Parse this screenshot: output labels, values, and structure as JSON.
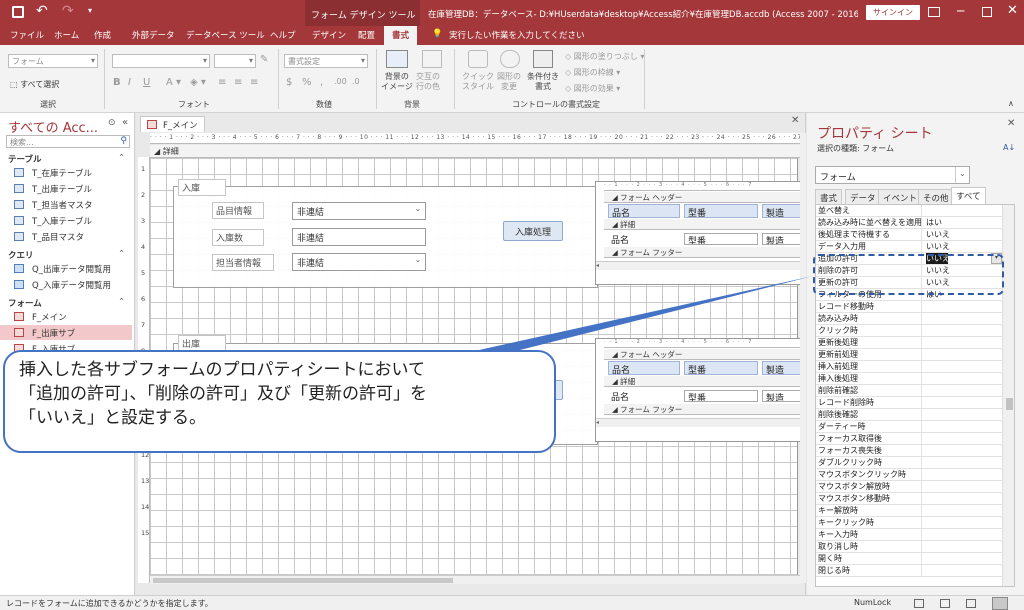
{
  "window": {
    "title": "在庫管理DB：データベース- D:¥HUserdata¥desktop¥Access紹介¥在庫管理DB.accdb (Access 2007 - 2016 フ...",
    "context_tab": "フォーム デザイン ツール",
    "signin": "サインイン"
  },
  "menu": {
    "tabs": [
      "ファイル",
      "ホーム",
      "作成",
      "外部データ",
      "データベース ツール",
      "ヘルプ",
      "デザイン",
      "配置",
      "書式"
    ],
    "active_tab": "書式",
    "tell_me": "実行したい作業を入力してください"
  },
  "ribbon": {
    "selection_combo": "フォーム",
    "select_all": "すべて選択",
    "group_selection": "選択",
    "font_combo": "",
    "group_font": "フォント",
    "number_format_combo": "書式設定",
    "group_number": "数値",
    "bg_image": "背景の\nイメージ",
    "alt_row_color": "交互の\n行の色",
    "group_background": "背景",
    "quick_style": "クイック\nスタイル",
    "change_shape": "図形の\n変更",
    "conditional_format": "条件付き\n書式",
    "shape_fill": "図形の塗りつぶし",
    "shape_outline": "図形の枠線",
    "shape_effects": "図形の効果",
    "group_control_format": "コントロールの書式設定"
  },
  "nav": {
    "header": "すべての Acc...",
    "search_placeholder": "検索...",
    "sections": [
      {
        "label": "テーブル",
        "items": [
          "T_在庫テーブル",
          "T_出庫テーブル",
          "T_担当者マスタ",
          "T_入庫テーブル",
          "T_品目マスタ"
        ]
      },
      {
        "label": "クエリ",
        "items": [
          "Q_出庫データ閲覧用",
          "Q_入庫データ閲覧用"
        ]
      },
      {
        "label": "フォーム",
        "items": [
          "F_メイン",
          "F_出庫サブ",
          "F_入庫サブ"
        ]
      }
    ],
    "selected": "F_出庫サブ"
  },
  "designer": {
    "doc_tab": "F_メイン",
    "section_detail": "詳細",
    "group_in": "入庫",
    "group_out": "出庫",
    "label_item": "品目情報",
    "label_qty": "入庫数",
    "label_staff": "担当者情報",
    "unbound": "非連結",
    "btn_in": "入庫処理",
    "ruler_numbers": [
      "1",
      "2",
      "3",
      "4",
      "5",
      "6",
      "7",
      "8",
      "9",
      "10",
      "11",
      "12",
      "13",
      "14",
      "15"
    ],
    "sub": {
      "form_header": "フォーム ヘッダー",
      "detail": "詳細",
      "form_footer": "フォーム フッター",
      "col_item": "品名",
      "col_no": "型番",
      "col_maker": "製造",
      "ruler": "· · 1 · · · 2 · · · 3 · · · 4 · · · 5 · · · 6 · · · 7"
    }
  },
  "props": {
    "title": "プロパティ シート",
    "selection_kind": "選択の種類: フォーム",
    "object": "フォーム",
    "tabs": [
      "書式",
      "データ",
      "イベント",
      "その他",
      "すべて"
    ],
    "active_tab": "すべて",
    "rows": [
      {
        "name": "並べ替え",
        "value": ""
      },
      {
        "name": "読み込み時に並べ替えを適用",
        "value": "はい"
      },
      {
        "name": "後処理まで待機する",
        "value": "いいえ"
      },
      {
        "name": "データ入力用",
        "value": "いいえ"
      },
      {
        "name": "追加の許可",
        "value": "いいえ"
      },
      {
        "name": "削除の許可",
        "value": "いいえ"
      },
      {
        "name": "更新の許可",
        "value": "いいえ"
      },
      {
        "name": "フィルターの使用",
        "value": "はい"
      },
      {
        "name": "レコード移動時",
        "value": ""
      },
      {
        "name": "読み込み時",
        "value": ""
      },
      {
        "name": "クリック時",
        "value": ""
      },
      {
        "name": "更新後処理",
        "value": ""
      },
      {
        "name": "更新前処理",
        "value": ""
      },
      {
        "name": "挿入前処理",
        "value": ""
      },
      {
        "name": "挿入後処理",
        "value": ""
      },
      {
        "name": "削除前確認",
        "value": ""
      },
      {
        "name": "レコード削除時",
        "value": ""
      },
      {
        "name": "削除後確認",
        "value": ""
      },
      {
        "name": "ダーティー時",
        "value": ""
      },
      {
        "name": "フォーカス取得後",
        "value": ""
      },
      {
        "name": "フォーカス喪失後",
        "value": ""
      },
      {
        "name": "ダブルクリック時",
        "value": ""
      },
      {
        "name": "マウスボタンクリック時",
        "value": ""
      },
      {
        "name": "マウスボタン解放時",
        "value": ""
      },
      {
        "name": "マウスボタン移動時",
        "value": ""
      },
      {
        "name": "キー解放時",
        "value": ""
      },
      {
        "name": "キークリック時",
        "value": ""
      },
      {
        "name": "キー入力時",
        "value": ""
      },
      {
        "name": "取り消し時",
        "value": ""
      },
      {
        "name": "開く時",
        "value": ""
      },
      {
        "name": "閉じる時",
        "value": ""
      }
    ]
  },
  "status": {
    "message": "レコードをフォームに追加できるかどうかを指定します。",
    "numlock": "NumLock"
  },
  "callout": {
    "text": "挿入した各サブフォームのプロパティシートにおいて\n「追加の許可」、「削除の許可」及び「更新の許可」を\n「いいえ」と設定する。"
  },
  "colors": {
    "accent": "#a4373a",
    "callout_border": "#4472c4",
    "dash": "#2f5ba4"
  }
}
